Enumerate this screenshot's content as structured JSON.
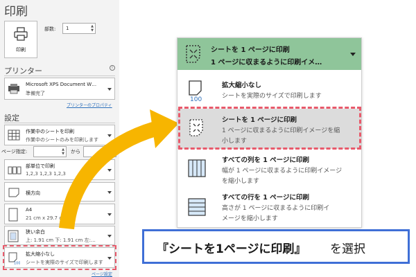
{
  "pane": {
    "title": "印刷",
    "print_button": "印刷",
    "copies_label": "部数:",
    "copies_value": "1",
    "printer_heading": "プリンター",
    "printer_name": "Microsoft XPS Document W…",
    "printer_status": "準備完了",
    "printer_properties": "プリンターのプロパティ",
    "settings_heading": "設定",
    "settings": [
      {
        "line1": "作業中のシートを印刷",
        "line2": "作業中のシートのみを印刷します"
      },
      {
        "line1": "部単位で印刷",
        "line2": "1,2,3    1,2,3    1,2,3"
      },
      {
        "line1": "横方向",
        "line2": ""
      },
      {
        "line1": "A4",
        "line2": "21 cm x 29.7 cm"
      },
      {
        "line1": "狭い余白",
        "line2": "上: 1.91 cm 下: 1.91 cm 左:…"
      },
      {
        "line1": "拡大縮小なし",
        "line2": "シートを実際のサイズで印刷します"
      }
    ],
    "pages_label": "ページ指定:",
    "pages_to": "から",
    "page_setup_link": "ページ設定"
  },
  "dropdown": {
    "selected_line1": "シートを 1 ページに印刷",
    "selected_line2": "1 ページに収まるように印刷イメ…",
    "options": [
      {
        "title": "拡大縮小なし",
        "desc1": "シートを実際のサイズで印刷します",
        "desc2": ""
      },
      {
        "title": "シートを 1 ページに印刷",
        "desc1": "1 ページに収まるように印刷イメージを縮",
        "desc2": "小します"
      },
      {
        "title": "すべての列を 1 ページに印刷",
        "desc1": "幅が 1 ページに収まるように印刷イメージ",
        "desc2": "を縮小します"
      },
      {
        "title": "すべての行を 1 ページに印刷",
        "desc1": "高さが 1 ページに収まるように印刷イ",
        "desc2": "メージを縮小します"
      }
    ]
  },
  "caption": {
    "main": "『シートを1ページに印刷』",
    "suffix": "を選択"
  },
  "colors": {
    "highlight": "#e85a6b",
    "selected_bg": "#8fc59a",
    "arrow": "#f7b500",
    "caption_border": "#3f6fd6"
  }
}
